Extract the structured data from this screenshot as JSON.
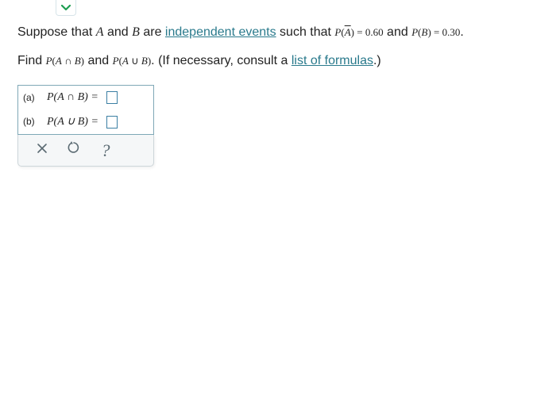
{
  "dropdown": {
    "icon": "chevron-down"
  },
  "prompt": {
    "l1_a": "Suppose that ",
    "var_A": "A",
    "l1_b": " and ",
    "var_B": "B",
    "l1_c": " are ",
    "link_events": "independent events",
    "l1_d": " such that ",
    "pAbar_lhs_P": "P",
    "pAbar_lhs_open": "(",
    "pAbar_lhs_var": "A",
    "pAbar_lhs_close": ")",
    "eq1": " = ",
    "pAbar_val": "0.60",
    "l1_e": " and ",
    "pB_lhs_P": "P",
    "pB_lhs_open": "(",
    "pB_lhs_var": "B",
    "pB_lhs_close": ")",
    "eq2": " = ",
    "pB_val": "0.30",
    "l1_f": ".",
    "l2_a": "Find ",
    "find1_P": "P",
    "find1_open": "(",
    "find1_A": "A",
    "find1_op": " ∩ ",
    "find1_B": "B",
    "find1_close": ")",
    "l2_b": " and ",
    "find2_P": "P",
    "find2_open": "(",
    "find2_A": "A",
    "find2_op": " ∪ ",
    "find2_B": "B",
    "find2_close": ")",
    "l2_c": ". (If necessary, consult a ",
    "link_formulas": "list of formulas",
    "l2_d": ".)"
  },
  "answers": {
    "a": {
      "label": "(a)",
      "expr": "P(A ∩ B) = "
    },
    "b": {
      "label": "(b)",
      "expr": "P(A ∪ B) = "
    }
  },
  "toolbar": {
    "clear": "×",
    "reset": "↺",
    "help": "?"
  }
}
